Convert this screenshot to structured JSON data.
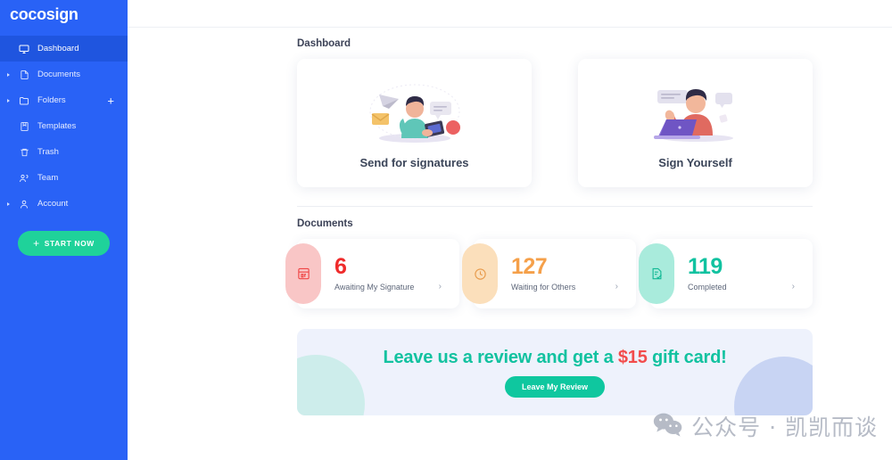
{
  "brand": {
    "name": "cocosign"
  },
  "sidebar": {
    "items": [
      {
        "label": "Dashboard",
        "icon": "monitor-icon",
        "active": true,
        "caret": false,
        "plus": false
      },
      {
        "label": "Documents",
        "icon": "document-icon",
        "active": false,
        "caret": true,
        "plus": false
      },
      {
        "label": "Folders",
        "icon": "folder-icon",
        "active": false,
        "caret": true,
        "plus": true
      },
      {
        "label": "Templates",
        "icon": "template-icon",
        "active": false,
        "caret": false,
        "plus": false
      },
      {
        "label": "Trash",
        "icon": "trash-icon",
        "active": false,
        "caret": false,
        "plus": false
      },
      {
        "label": "Team",
        "icon": "team-icon",
        "active": false,
        "caret": false,
        "plus": false
      },
      {
        "label": "Account",
        "icon": "account-icon",
        "active": false,
        "caret": true,
        "plus": false
      }
    ],
    "start_button": {
      "label": "START NOW",
      "icon": "plus-icon",
      "color": "#1fd29a"
    },
    "background_color": "#2962f6",
    "active_color": "#1f55df"
  },
  "main": {
    "dashboard_title": "Dashboard",
    "action_cards": [
      {
        "label": "Send for signatures",
        "illustration": "person-sending-mail-illustration"
      },
      {
        "label": "Sign Yourself",
        "illustration": "person-at-laptop-illustration"
      }
    ],
    "documents_title": "Documents",
    "stats": [
      {
        "value": "6",
        "label": "Awaiting My Signature",
        "icon": "signature-doc-icon",
        "color": "#ef2b2b",
        "pill_color": "#f9c6c6",
        "chevron": "›"
      },
      {
        "value": "127",
        "label": "Waiting for Others",
        "icon": "clock-icon",
        "color": "#f5a04a",
        "pill_color": "#fbdfbb",
        "chevron": "›"
      },
      {
        "value": "119",
        "label": "Completed",
        "icon": "doc-check-icon",
        "color": "#11c2a0",
        "pill_color": "#a9ebdc",
        "chevron": "›"
      }
    ],
    "banner": {
      "headline_prefix": "Leave us a review and get a ",
      "headline_amount": "$15",
      "headline_suffix": " gift card!",
      "button_label": "Leave My Review",
      "background_color": "#eef2fc",
      "text_color": "#12c2a0",
      "amount_color": "#f24c4c"
    }
  },
  "watermark": {
    "text": "公众号 · 凯凯而谈",
    "icon": "wechat-icon"
  }
}
